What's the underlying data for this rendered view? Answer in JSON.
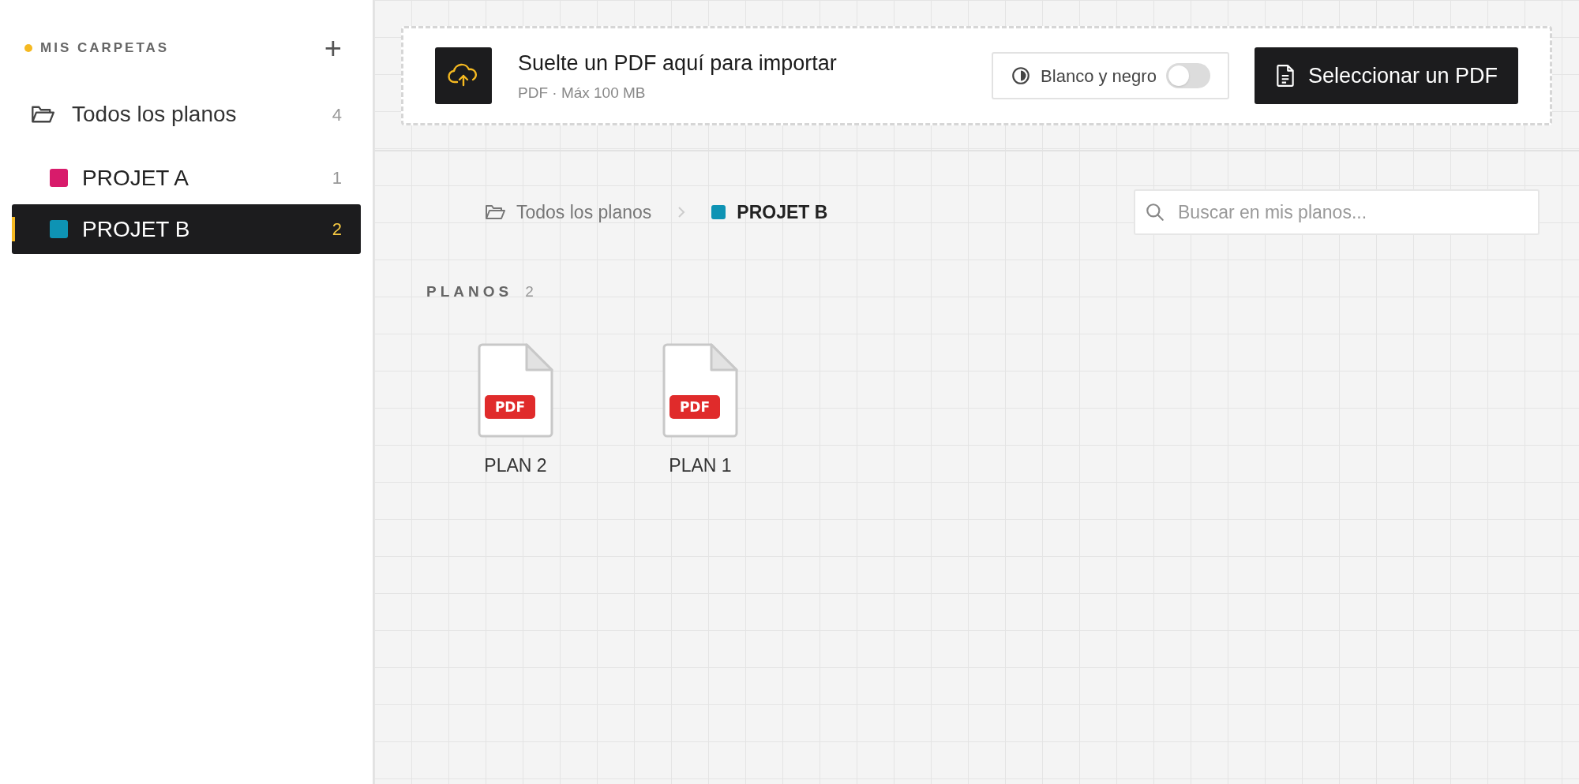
{
  "sidebar": {
    "title": "MIS CARPETAS",
    "add_icon": "+",
    "all": {
      "label": "Todos los planos",
      "count": "4"
    },
    "folders": [
      {
        "label": "PROJET A",
        "count": "1",
        "color": "#d81b6b",
        "selected": false
      },
      {
        "label": "PROJET B",
        "count": "2",
        "color": "#0e93b4",
        "selected": true
      }
    ]
  },
  "upload": {
    "title": "Suelte un PDF aquí para importar",
    "subtitle": "PDF · Máx 100 MB",
    "toggle": {
      "label": "Blanco y negro",
      "on": false
    },
    "button": "Seleccionar un PDF"
  },
  "breadcrumb": {
    "root": "Todos los planos",
    "current": "PROJET B",
    "color": "#0e93b4"
  },
  "search": {
    "placeholder": "Buscar en mis planos..."
  },
  "section": {
    "title": "PLANOS",
    "count": "2"
  },
  "files": [
    {
      "name": "PLAN 2",
      "badge": "PDF"
    },
    {
      "name": "PLAN 1",
      "badge": "PDF"
    }
  ]
}
